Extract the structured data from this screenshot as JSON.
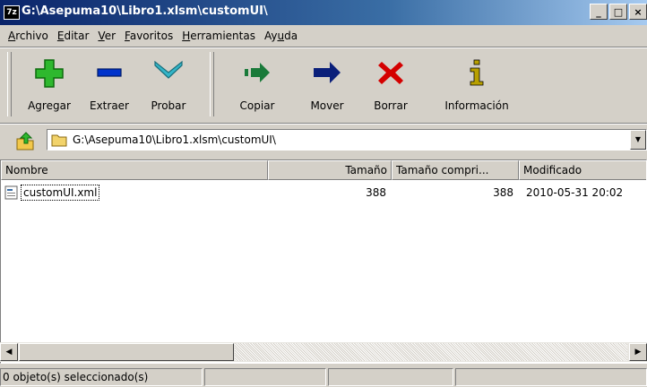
{
  "window": {
    "app_icon": "7z",
    "title": "G:\\Asepuma10\\Libro1.xlsm\\customUI\\",
    "caption_buttons": {
      "minimize": "_",
      "maximize": "□",
      "close": "×"
    }
  },
  "menu": {
    "items": [
      {
        "first": "A",
        "rest": "rchivo"
      },
      {
        "first": "E",
        "rest": "ditar"
      },
      {
        "first": "V",
        "rest": "er"
      },
      {
        "first": "F",
        "rest": "avoritos"
      },
      {
        "first": "H",
        "rest": "erramientas"
      },
      {
        "first": "Ay",
        "ul": "u",
        "rest": "da"
      }
    ]
  },
  "toolbar": {
    "buttons": [
      {
        "label": "Agregar",
        "icon": "plus-icon",
        "color": "#2eb82e"
      },
      {
        "label": "Extraer",
        "icon": "minus-icon",
        "color": "#0033cc"
      },
      {
        "label": "Probar",
        "icon": "check-chevron-icon",
        "color": "#33b5c8"
      },
      {
        "label": "Copiar",
        "icon": "copy-arrow-icon",
        "color": "#1a7a3a"
      },
      {
        "label": "Mover",
        "icon": "move-arrow-icon",
        "color": "#0a1f7a"
      },
      {
        "label": "Borrar",
        "icon": "delete-x-icon",
        "color": "#d40000"
      },
      {
        "label": "Información",
        "icon": "info-icon",
        "color": "#b8a000"
      }
    ]
  },
  "address": {
    "path": "G:\\Asepuma10\\Libro1.xlsm\\customUI\\",
    "dropdown_glyph": "▼"
  },
  "list": {
    "columns": [
      "Nombre",
      "Tamaño",
      "Tamaño compri...",
      "Modificado"
    ],
    "rows": [
      {
        "name": "customUI.xml",
        "size": "388",
        "packed": "388",
        "modified": "2010-05-31 20:02"
      }
    ]
  },
  "scroll": {
    "left": "◀",
    "right": "▶"
  },
  "status": {
    "selection": "0 objeto(s) seleccionado(s)"
  }
}
